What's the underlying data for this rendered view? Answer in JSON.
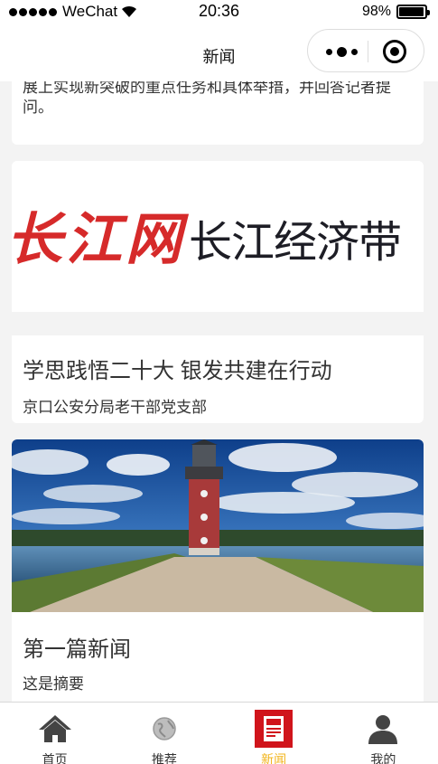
{
  "status_bar": {
    "carrier": "WeChat",
    "time": "20:36",
    "battery": "98%",
    "battery_level": 0.98
  },
  "nav": {
    "title": "新闻"
  },
  "articles": [
    {
      "summary": "“个 我首贝身 一国 ”第 市 之区 ”建设，在促进区域协调发展上实现新突破的重点任务和具体举措，并回答记者提问。"
    },
    {
      "banner_red": "长江网",
      "banner_black": "长江经济带",
      "title": "学思践悟二十大 银发共建在行动",
      "subtitle": "京口公安分局老干部党支部"
    },
    {
      "title": "第一篇新闻",
      "subtitle": "这是摘要"
    }
  ],
  "tabs": [
    {
      "label": "首页",
      "icon": "home-icon"
    },
    {
      "label": "推荐",
      "icon": "globe-icon"
    },
    {
      "label": "新闻",
      "icon": "newspaper-icon",
      "active": true
    },
    {
      "label": "我的",
      "icon": "user-icon"
    }
  ],
  "colors": {
    "active_tab": "#f2b51c",
    "news_icon_bg": "#d0141b",
    "banner_red": "#d62a2a"
  }
}
